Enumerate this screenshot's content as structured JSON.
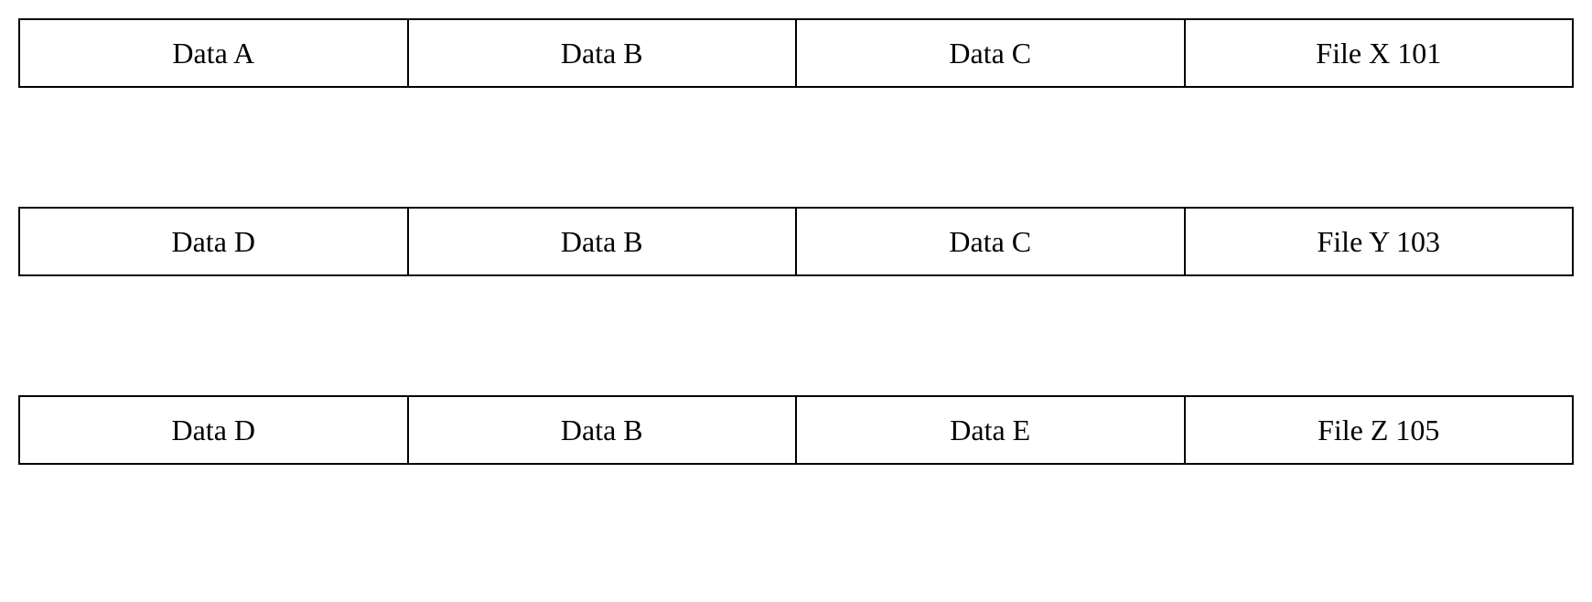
{
  "rows": [
    {
      "cells": [
        "Data A",
        "Data B",
        "Data C",
        "File X 101"
      ]
    },
    {
      "cells": [
        "Data D",
        "Data B",
        "Data C",
        "File Y 103"
      ]
    },
    {
      "cells": [
        "Data D",
        "Data B",
        "Data E",
        "File Z 105"
      ]
    }
  ]
}
